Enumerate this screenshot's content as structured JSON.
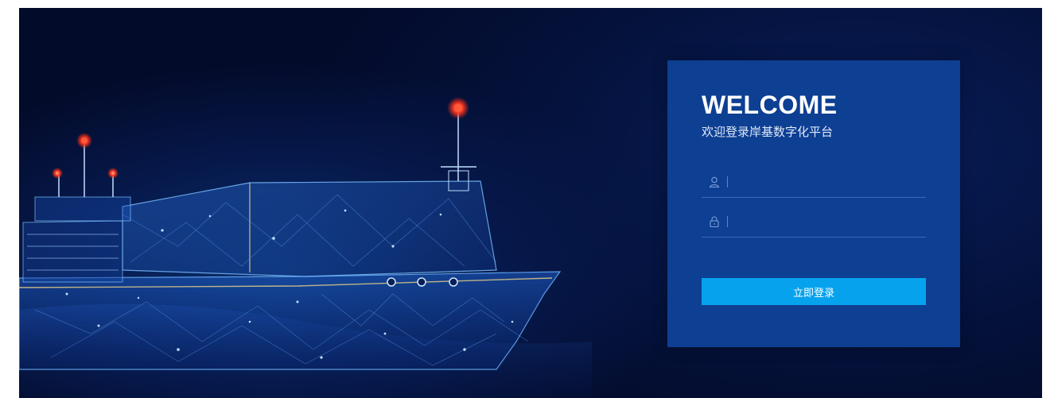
{
  "login": {
    "title": "WELCOME",
    "subtitle": "欢迎登录岸基数字化平台",
    "username": {
      "value": "",
      "placeholder": "",
      "icon": "user-icon"
    },
    "password": {
      "value": "",
      "placeholder": "",
      "icon": "lock-icon"
    },
    "submit_label": "立即登录"
  },
  "colors": {
    "background": "#040f33",
    "panel": "#0d3f92",
    "button": "#07a2ee",
    "text": "#ffffff"
  }
}
